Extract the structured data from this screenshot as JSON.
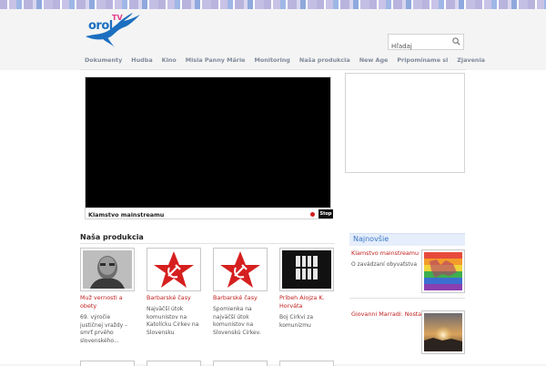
{
  "brand": {
    "name": "orol",
    "suffix": "TV",
    "color": "#1c6fc0",
    "accent": "#e23a8a"
  },
  "search": {
    "placeholder": "Hľadaj"
  },
  "nav": {
    "items": [
      "Dokumenty",
      "Hudba",
      "Kino",
      "Misia Panny Márie",
      "Monitoring",
      "Naša produkcia",
      "New Age",
      "Pripomíname si",
      "Zjavenia"
    ]
  },
  "video": {
    "caption": "Klamstvo mainstreamu",
    "stop_label": "Stop"
  },
  "section": {
    "title": "Naša produkcia"
  },
  "cards": [
    {
      "title": "Muž vernosti a obety",
      "desc": "69. výročie justičnej vraždy – smrť prvého slovenského...",
      "icon": "portrait-photo"
    },
    {
      "title": "Barbarské časy",
      "desc": "Najväčší útok komunistov na Katolícku Cirkev na Slovensku",
      "icon": "hammer-sickle-star"
    },
    {
      "title": "Barbarské časy",
      "desc": "Spomienka na najväčší útok komunistov na Slovenskú Cirkev.",
      "icon": "hammer-sickle-star"
    },
    {
      "title": "Príbeh Alojza K. Horváta",
      "desc": "Boj Cirkvi za komunizmu",
      "icon": "prison-window"
    }
  ],
  "sidebar": {
    "heading": "Najnovšie",
    "items": [
      {
        "title": "Klamstvo mainstreamu",
        "desc": "O zavádzaní obyvaťstva",
        "icon": "rainbow-flag"
      },
      {
        "title": "Giovanni Marradi: Nostalgie",
        "desc": "",
        "icon": "sunset"
      }
    ]
  },
  "colors": {
    "link": "#c21f1f",
    "nav": "#7f8a9a",
    "sidebar_head": "#3876c8"
  }
}
